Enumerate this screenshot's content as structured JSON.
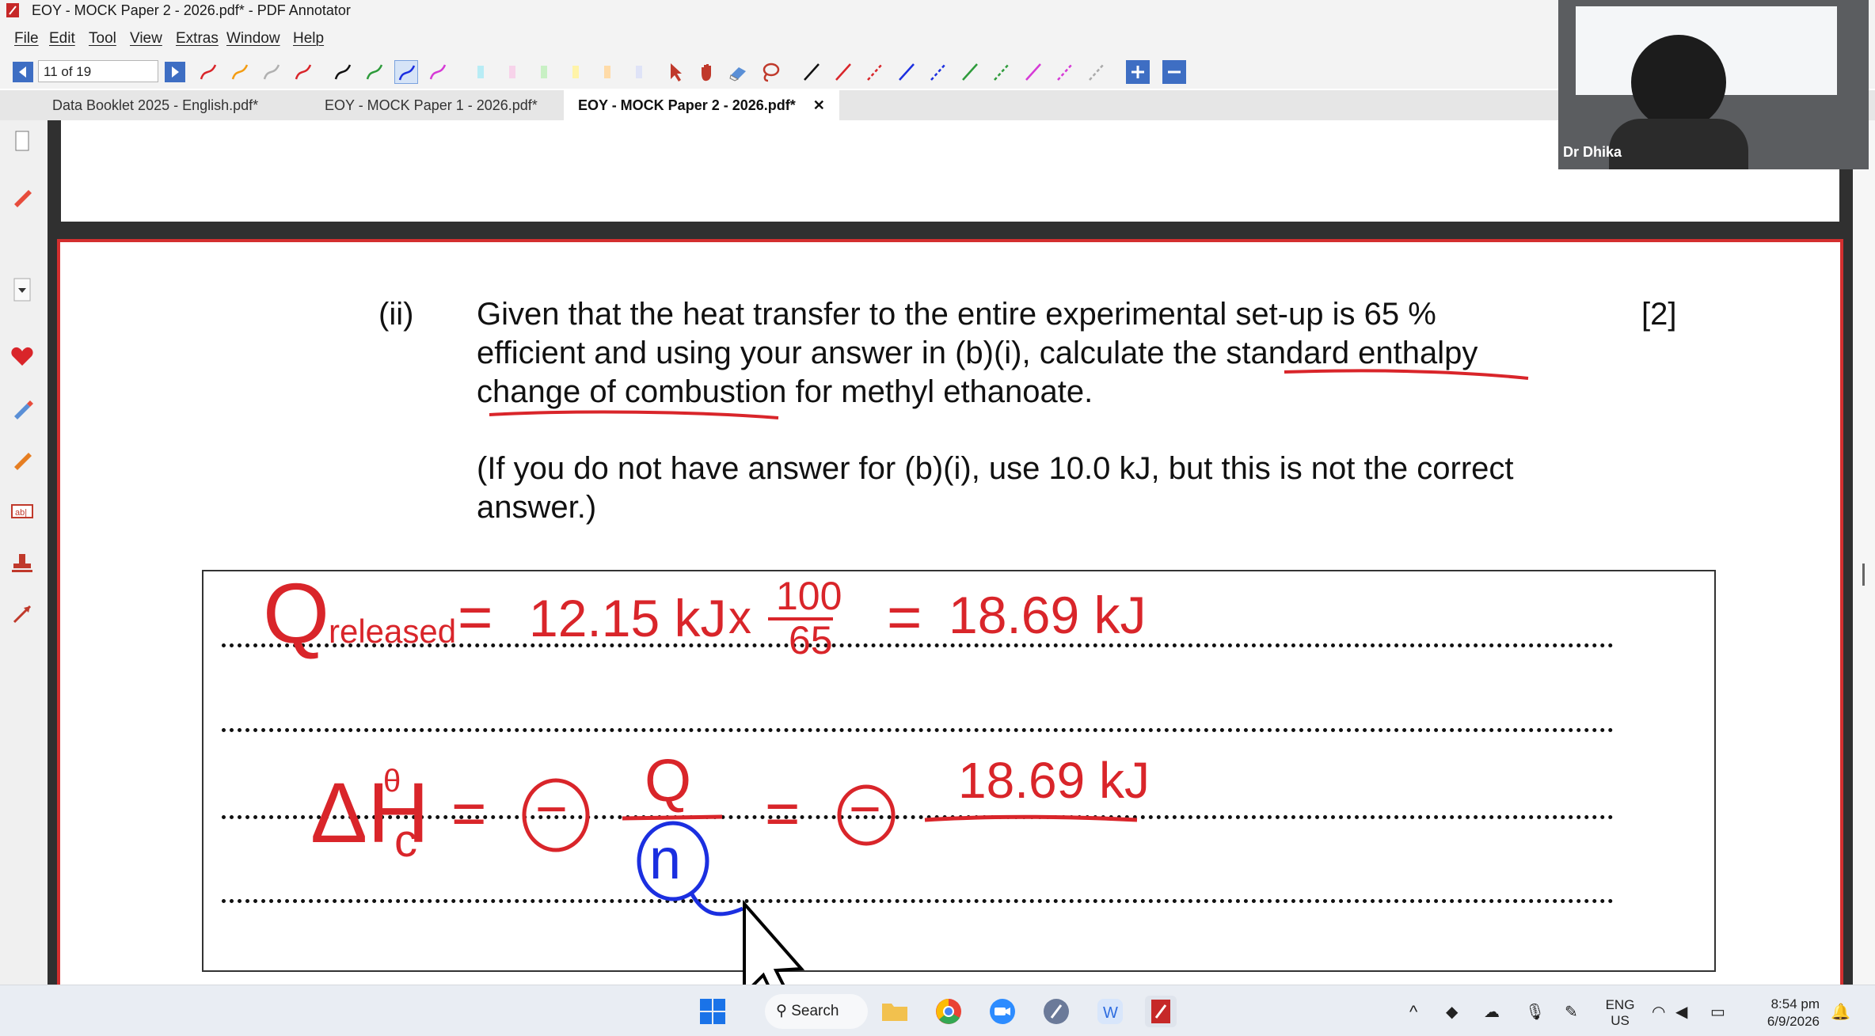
{
  "window": {
    "title": "EOY - MOCK Paper 2 - 2026.pdf* - PDF Annotator"
  },
  "menu": [
    "File",
    "Edit",
    "Tool",
    "View",
    "Extras",
    "Window",
    "Help"
  ],
  "toolbar": {
    "page_indicator": "11 of 19"
  },
  "tabs": [
    {
      "label": "Data Booklet 2025 - English.pdf*",
      "active": false
    },
    {
      "label": "EOY - MOCK Paper 1 - 2026.pdf*",
      "active": false
    },
    {
      "label": "EOY - MOCK Paper 2 - 2026.pdf*",
      "active": true
    }
  ],
  "question": {
    "number": "(ii)",
    "marks": "[2]",
    "line1": "Given that the heat transfer to the entire experimental set-up is 65 %",
    "line2": "efficient and using your answer in (b)(i), calculate the standard enthalpy",
    "line3": "change of combustion for methyl ethanoate.",
    "note_line1": "(If you do not have answer for (b)(i), use 10.0 kJ, but this is not the correct",
    "note_line2": "answer.)"
  },
  "handwriting": {
    "q_symbol": "Q",
    "q_subscript": "released",
    "equals": "=",
    "value1": "12.15 kJ",
    "times": "x",
    "frac_num": "100",
    "frac_den": "65",
    "result": "18.69 kJ",
    "delta_h": "ΔH",
    "superscript": "θ",
    "subscript_c": "c",
    "minus": "−",
    "q_over": "Q",
    "n_under": "n",
    "final_num": "18.69 kJ"
  },
  "webcam": {
    "name": "Dr Dhika"
  },
  "taskbar": {
    "search_label": "Search",
    "language_top": "ENG",
    "language_bottom": "US",
    "time": "8:54 pm",
    "date": "6/9/2026"
  },
  "colors": {
    "ink_red": "#d9252a",
    "ink_blue": "#1b2fe0",
    "accent_blue": "#3e6ec3",
    "doc_border": "#d32f2f"
  }
}
